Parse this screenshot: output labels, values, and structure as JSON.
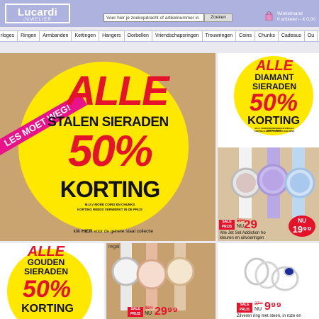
{
  "header": {
    "logo_main": "Lucardi",
    "logo_sub": "JUWELIER",
    "search_placeholder": "Voer hier je zoekopdracht of artikelnummer in",
    "search_button": "Zoeken",
    "cart_title": "Winkelmand",
    "cart_summary": "0 artikelen - € 0,00"
  },
  "nav": {
    "items": [
      "rloges",
      "Ringen",
      "Armbanden",
      "Kettingen",
      "Hangers",
      "Oorbellen",
      "Vriendschapsringen",
      "Trouwringen",
      "Coins",
      "Chunks",
      "Cadeaus",
      "Ou"
    ]
  },
  "main_banner": {
    "ribbon": "LES MOET WEG!",
    "alle": "ALLE",
    "line1": "STALEN SIERADEN",
    "percent": "50%",
    "korting": "KORTING",
    "footnote1": "M.U.V MORE COINS EN CHUNKS",
    "footnote2": "KORTING REEDS VERWERKT IN DE PRIJS",
    "cta_prefix": "klik",
    "cta_link": "HIER",
    "cta_suffix": "voor de gehele staal collectie"
  },
  "diamant_promo": {
    "alle": "ALLE",
    "line1": "DIAMANT",
    "line2": "SIERADEN",
    "percent": "50%",
    "korting": "KORTING",
    "footnote1": "M.U.V. TRANSPERIJSRINGEN EN SPECIALE BESTELLINGEN",
    "footnote2": "KORTING IS REEDS VERWERKT IN DE PRIJS"
  },
  "watch_promo": {
    "sale_label": "SALE PRIJS",
    "old_price": "59⁹⁵",
    "now_label": "NU",
    "price": "29",
    "badge_now": "NU",
    "badge_price": "19⁹⁹",
    "caption1": "Alle Jet Set Addiction ho",
    "caption2": "kleuren en uitvoeringen"
  },
  "gouden_promo": {
    "alle": "ALLE",
    "line1": "GOUDEN",
    "line2": "SIERADEN",
    "percent": "50%",
    "korting": "KORTING"
  },
  "regal_watches": {
    "brand": "regal",
    "sale_label": "SALE PRIJS",
    "old_price": "49⁹⁵",
    "now_label": "NU",
    "price": "29⁹⁹"
  },
  "rings_promo": {
    "sale_label": "SALE PRIJS",
    "old_price": "27⁹⁵",
    "now_label": "NU",
    "price": "9⁹⁹",
    "caption": "Zilveren ring met steen, in roze en"
  }
}
